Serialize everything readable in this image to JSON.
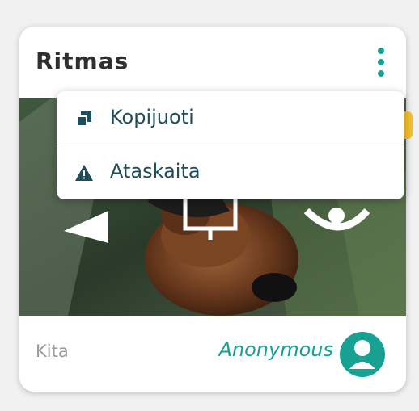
{
  "card": {
    "title": "Ritmas",
    "category": "Kita",
    "author": "Anonymous"
  },
  "menu": {
    "items": [
      {
        "label": "Kopijuoti",
        "icon": "copy-icon"
      },
      {
        "label": "Ataskaita",
        "icon": "warning-icon"
      }
    ]
  },
  "icons": {
    "more": "kebab-menu-icon",
    "avatar": "user-avatar-icon",
    "play": "play-icon"
  },
  "colors": {
    "accent": "#16a193",
    "menu_text": "#1f4d5c",
    "category_text": "#9a9a9a",
    "side_tab": "#f3c02b"
  }
}
